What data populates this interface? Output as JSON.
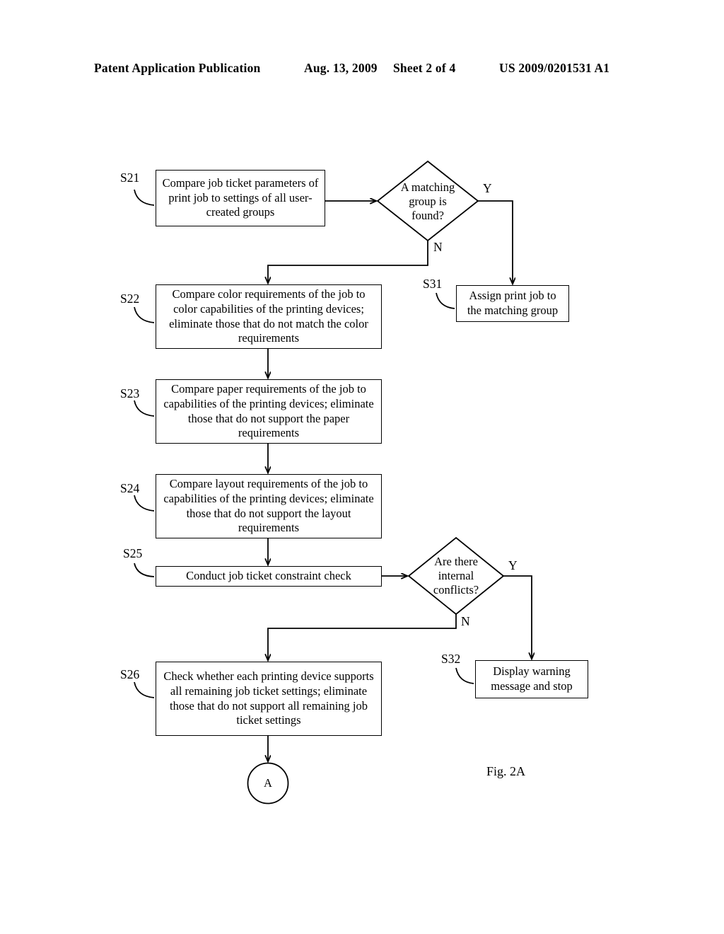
{
  "header": {
    "publication": "Patent Application Publication",
    "date": "Aug. 13, 2009",
    "sheet": "Sheet 2 of 4",
    "number": "US 2009/0201531 A1"
  },
  "figure": {
    "caption": "Fig. 2A"
  },
  "steps": {
    "s21": {
      "label": "S21",
      "text": "Compare job ticket parameters of print job to settings of all user-created groups"
    },
    "s22": {
      "label": "S22",
      "text": "Compare color requirements of the job to color capabilities of the printing devices; eliminate those that do not match the color requirements"
    },
    "s23": {
      "label": "S23",
      "text": "Compare paper requirements of the job to capabilities of the printing devices; eliminate those that do not support the paper requirements"
    },
    "s24": {
      "label": "S24",
      "text": "Compare layout requirements of the job to capabilities of the printing devices; eliminate those that do not support the layout requirements"
    },
    "s25": {
      "label": "S25",
      "text": "Conduct job ticket constraint check"
    },
    "s26": {
      "label": "S26",
      "text": "Check whether each printing device supports all remaining job ticket settings; eliminate those that do not support all remaining job ticket settings"
    },
    "s31": {
      "label": "S31",
      "text": "Assign print job to the matching group"
    },
    "s32": {
      "label": "S32",
      "text": "Display warning message and stop"
    }
  },
  "decisions": {
    "d1": {
      "line1": "A matching",
      "line2": "group is",
      "line3": "found?",
      "yes": "Y",
      "no": "N"
    },
    "d2": {
      "line1": "Are there",
      "line2": "internal",
      "line3": "conflicts?",
      "yes": "Y",
      "no": "N"
    }
  },
  "connector": {
    "label": "A"
  },
  "colors": {
    "stroke": "#000000",
    "background": "#ffffff"
  }
}
